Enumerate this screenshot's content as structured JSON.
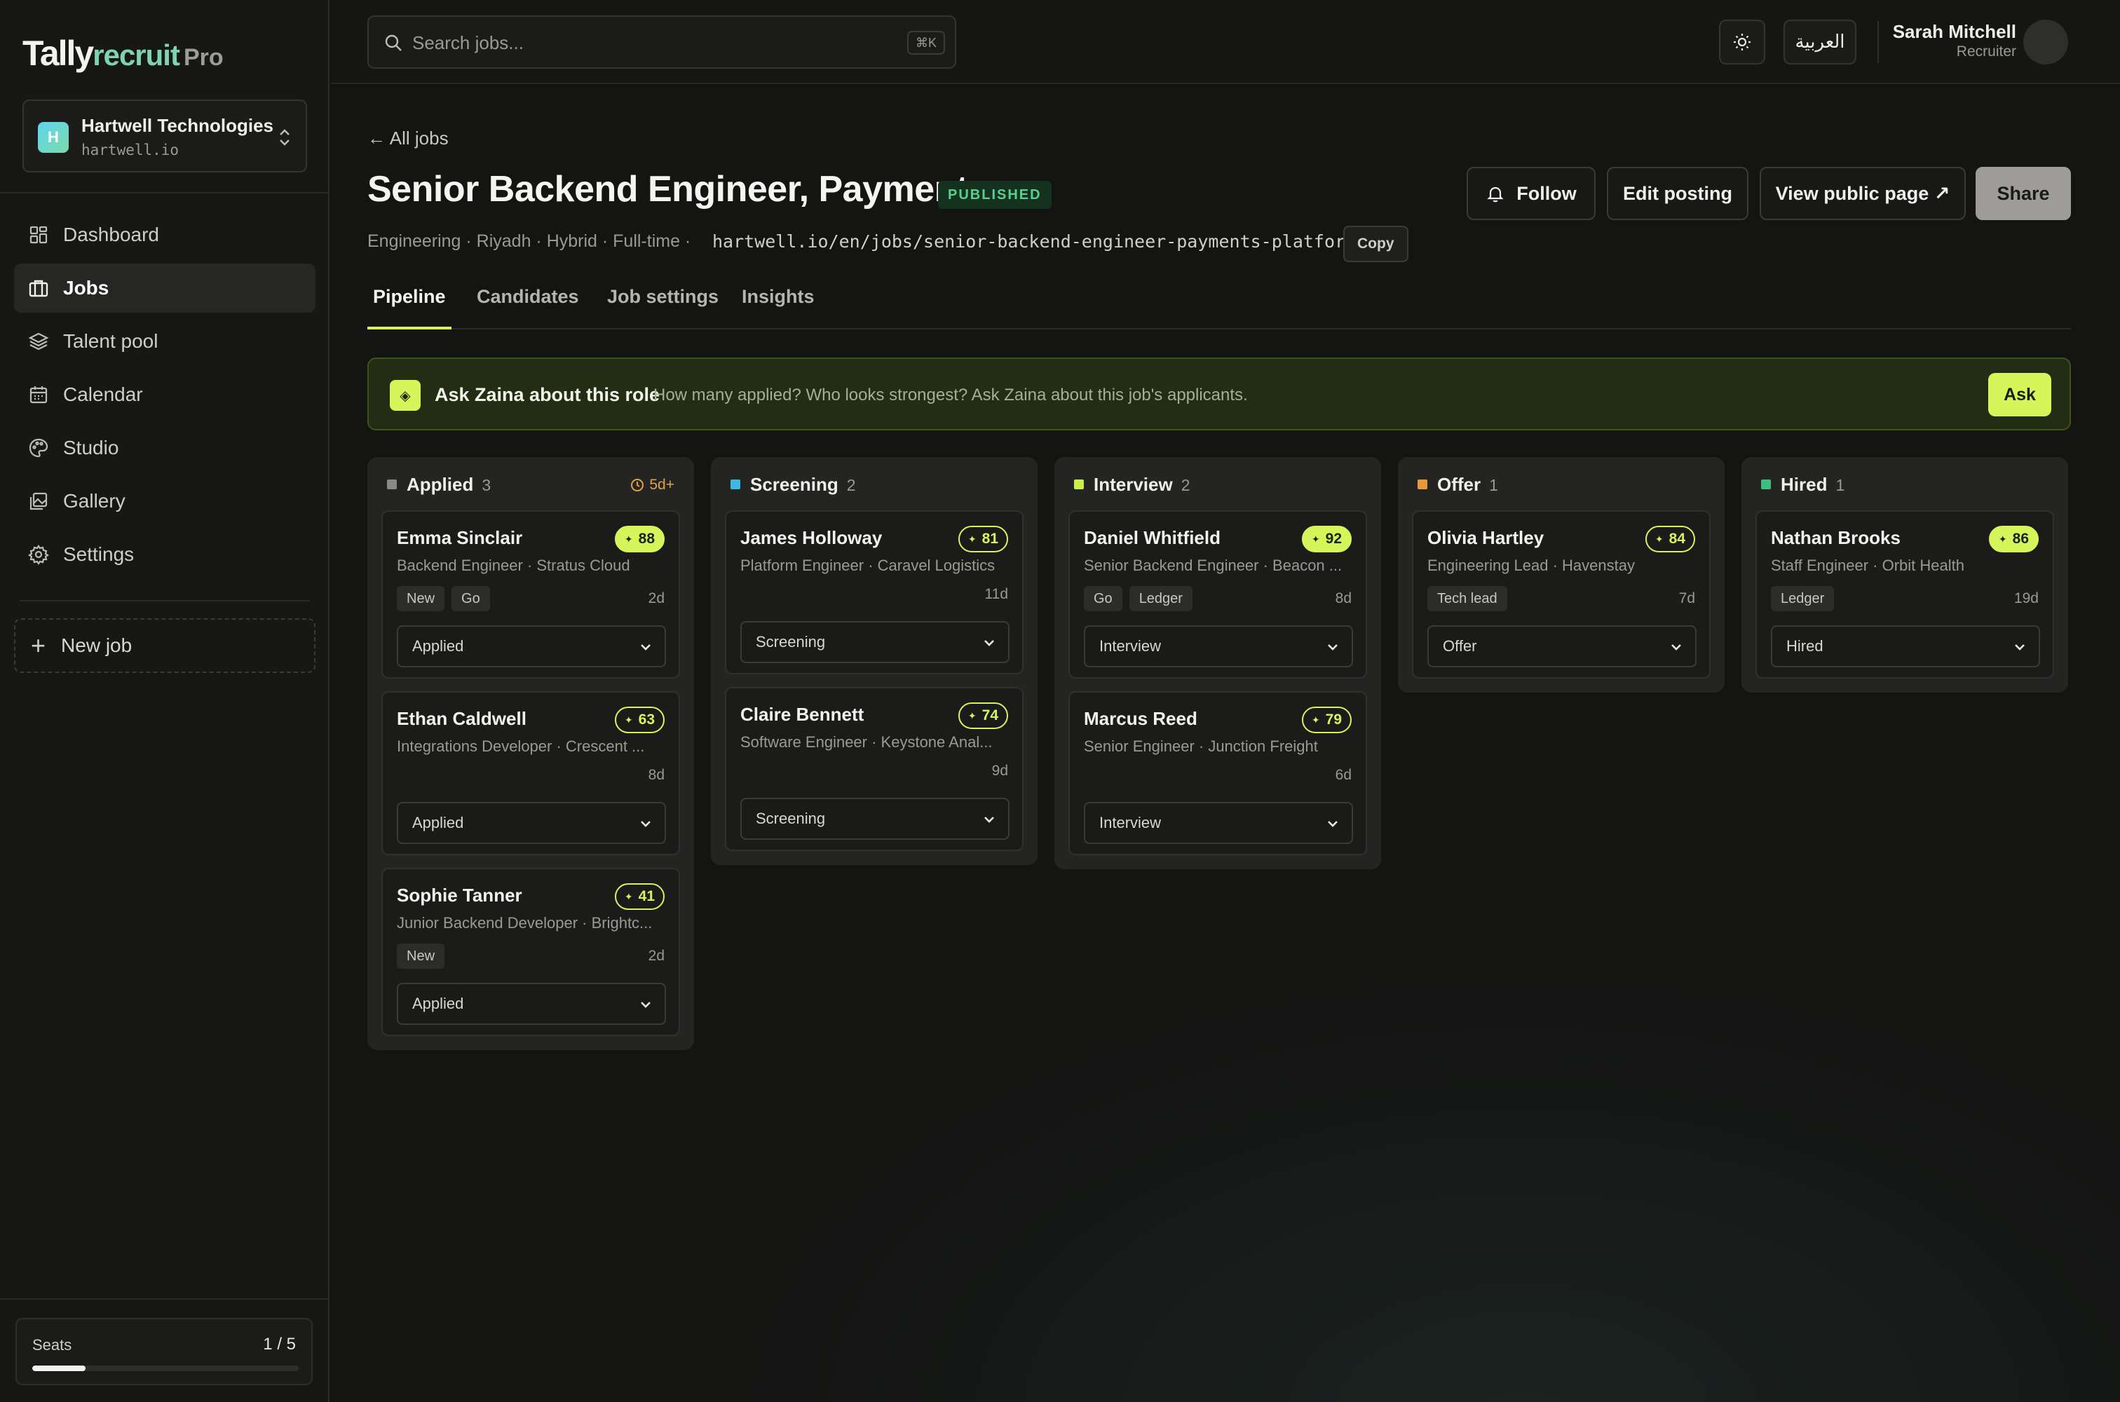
{
  "brand": {
    "part1": "Tally",
    "part2": "recruit",
    "part3": "Pro"
  },
  "org": {
    "initial": "H",
    "name": "Hartwell Technologies",
    "domain": "hartwell.io"
  },
  "nav": [
    {
      "label": "Dashboard",
      "icon": "dashboard-icon"
    },
    {
      "label": "Jobs",
      "icon": "briefcase-icon"
    },
    {
      "label": "Talent pool",
      "icon": "layers-icon"
    },
    {
      "label": "Calendar",
      "icon": "calendar-icon"
    },
    {
      "label": "Studio",
      "icon": "palette-icon"
    },
    {
      "label": "Gallery",
      "icon": "gallery-icon"
    },
    {
      "label": "Settings",
      "icon": "gear-icon"
    }
  ],
  "new_job": {
    "label": "New job"
  },
  "seats": {
    "label": "Seats",
    "value": "1 / 5",
    "used": 1,
    "total": 5
  },
  "topbar": {
    "search_placeholder": "Search jobs...",
    "shortcut": "⌘K",
    "language": "العربية"
  },
  "user": {
    "name": "Sarah Mitchell",
    "role": "Recruiter"
  },
  "job": {
    "back": "← All jobs",
    "title": "Senior Backend Engineer, Payments",
    "status": "PUBLISHED",
    "meta": "Engineering · Riyadh · Hybrid · Full-time   ·",
    "url": "hartwell.io/en/jobs/senior-backend-engineer-payments-platform",
    "copy": "Copy"
  },
  "actions": {
    "follow": "Follow",
    "edit": "Edit posting",
    "view": "View public page ↗",
    "share": "Share"
  },
  "tabs": [
    "Pipeline",
    "Candidates",
    "Job settings",
    "Insights"
  ],
  "assistant": {
    "icon": "sparkle-icon",
    "title": "Ask Zaina about this role",
    "subtitle": "How many applied? Who looks strongest? Ask Zaina about this job's applicants.",
    "button": "Ask"
  },
  "columns": [
    {
      "name": "Applied",
      "count": "3",
      "color": "#8a8a85",
      "sla": "5d+",
      "cards": [
        {
          "name": "Emma Sinclair",
          "score": "88",
          "high": true,
          "role": "Backend Engineer · Stratus Cloud",
          "tags": [
            "New",
            "Go"
          ],
          "age": "2d",
          "stage": "Applied"
        },
        {
          "name": "Ethan Caldwell",
          "score": "63",
          "high": false,
          "role": "Integrations Developer · Crescent ...",
          "tags": [],
          "age": "8d",
          "stage": "Applied"
        },
        {
          "name": "Sophie Tanner",
          "score": "41",
          "high": false,
          "role": "Junior Backend Developer · Brightc...",
          "tags": [
            "New"
          ],
          "age": "2d",
          "stage": "Applied"
        }
      ]
    },
    {
      "name": "Screening",
      "count": "2",
      "color": "#3fb7e0",
      "sla": "",
      "cards": [
        {
          "name": "James Holloway",
          "score": "81",
          "high": false,
          "role": "Platform Engineer · Caravel Logistics",
          "tags": [],
          "age": "11d",
          "stage": "Screening"
        },
        {
          "name": "Claire Bennett",
          "score": "74",
          "high": false,
          "role": "Software Engineer · Keystone Anal...",
          "tags": [],
          "age": "9d",
          "stage": "Screening"
        }
      ]
    },
    {
      "name": "Interview",
      "count": "2",
      "color": "#c8ef4a",
      "sla": "",
      "cards": [
        {
          "name": "Daniel Whitfield",
          "score": "92",
          "high": true,
          "role": "Senior Backend Engineer · Beacon ...",
          "tags": [
            "Go",
            "Ledger"
          ],
          "age": "8d",
          "stage": "Interview"
        },
        {
          "name": "Marcus Reed",
          "score": "79",
          "high": false,
          "role": "Senior Engineer · Junction Freight",
          "tags": [],
          "age": "6d",
          "stage": "Interview"
        }
      ]
    },
    {
      "name": "Offer",
      "count": "1",
      "color": "#e49a3d",
      "sla": "",
      "cards": [
        {
          "name": "Olivia Hartley",
          "score": "84",
          "high": false,
          "role": "Engineering Lead · Havenstay",
          "tags": [
            "Tech lead"
          ],
          "age": "7d",
          "stage": "Offer"
        }
      ]
    },
    {
      "name": "Hired",
      "count": "1",
      "color": "#3fbf7f",
      "sla": "",
      "cards": [
        {
          "name": "Nathan Brooks",
          "score": "86",
          "high": true,
          "role": "Staff Engineer · Orbit Health",
          "tags": [
            "Ledger"
          ],
          "age": "19d",
          "stage": "Hired"
        }
      ]
    }
  ]
}
